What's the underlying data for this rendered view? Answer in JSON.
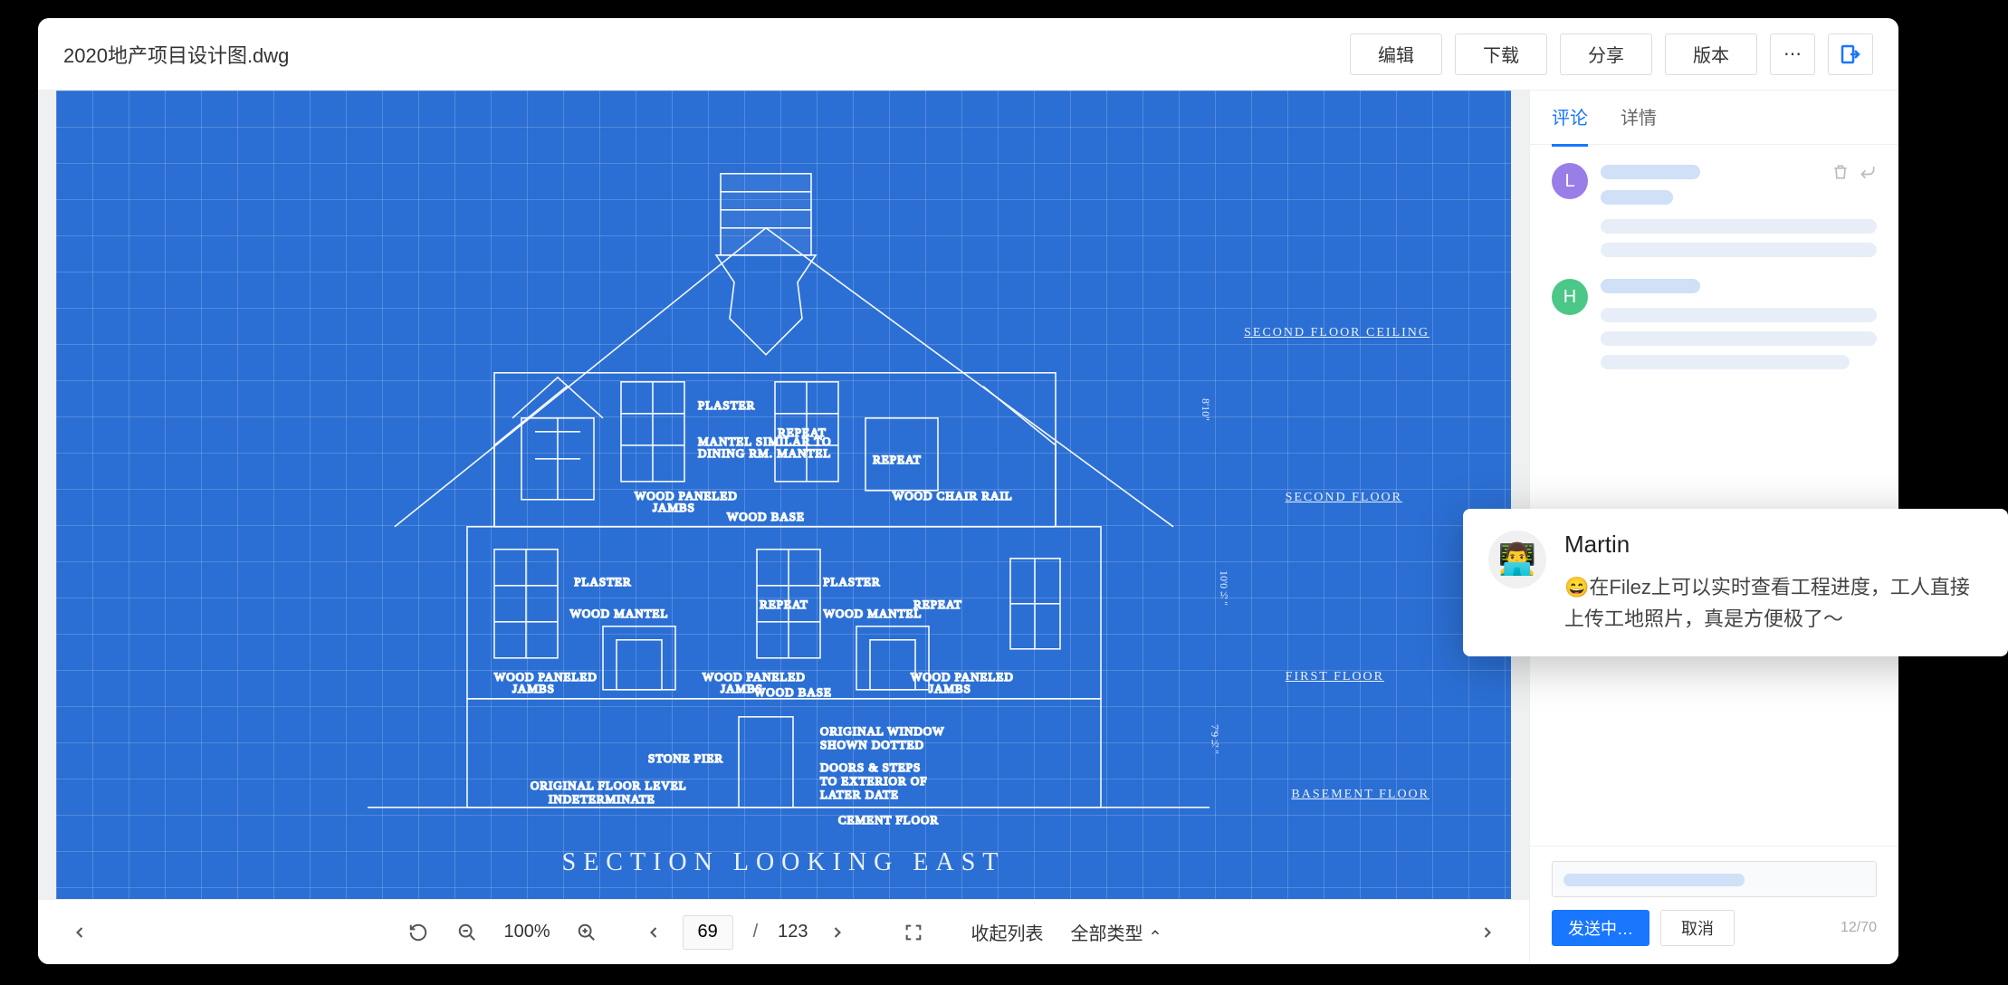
{
  "header": {
    "filename": "2020地产项目设计图.dwg",
    "buttons": {
      "edit": "编辑",
      "download": "下载",
      "share": "分享",
      "version": "版本"
    }
  },
  "blueprint": {
    "title": "SECTION  LOOKING  EAST",
    "floors": {
      "second_ceiling": "SECOND FLOOR CEILING",
      "second": "SECOND  FLOOR",
      "first": "FIRST  FLOOR",
      "basement": "BASEMENT  FLOOR"
    },
    "dims": {
      "upper": "8'10\"",
      "mid": "10'0½\"",
      "lower": "7'9½\""
    },
    "labels": {
      "plaster": "PLASTER",
      "repeat": "REPEAT",
      "mantel_similar": "MANTEL SIMILAR TO\nDINING RM. MANTEL",
      "wood_paneled_jambs": "WOOD PANELED\nJAMBS",
      "wood_base": "WOOD BASE",
      "wood_chair_rail": "WOOD CHAIR RAIL",
      "wood_mantel": "WOOD MANTEL",
      "stone_pier": "STONE PIER",
      "original_floor": "ORIGINAL FLOOR LEVEL\nINDETERMINATE",
      "original_window": "ORIGINAL WINDOW\nSHOWN DOTTED",
      "doors_steps": "DOORS & STEPS\nTO EXTERIOR OF\nLATER DATE",
      "cement_floor": "CEMENT FLOOR"
    }
  },
  "bottombar": {
    "zoom": "100%",
    "page_current": "69",
    "page_total": "123",
    "collapse_list": "收起列表",
    "all_types": "全部类型"
  },
  "sidebar": {
    "tabs": {
      "comments": "评论",
      "details": "详情"
    },
    "avatars": {
      "a": "L",
      "b": "H"
    },
    "colors": {
      "a": "#9a7ee8",
      "b": "#4bc787"
    }
  },
  "compose": {
    "send": "发送中…",
    "cancel": "取消",
    "counter": "12/70"
  },
  "popup": {
    "name": "Martin",
    "text": "😄在Filez上可以实时查看工程进度，工人直接上传工地照片，真是方便极了～"
  }
}
